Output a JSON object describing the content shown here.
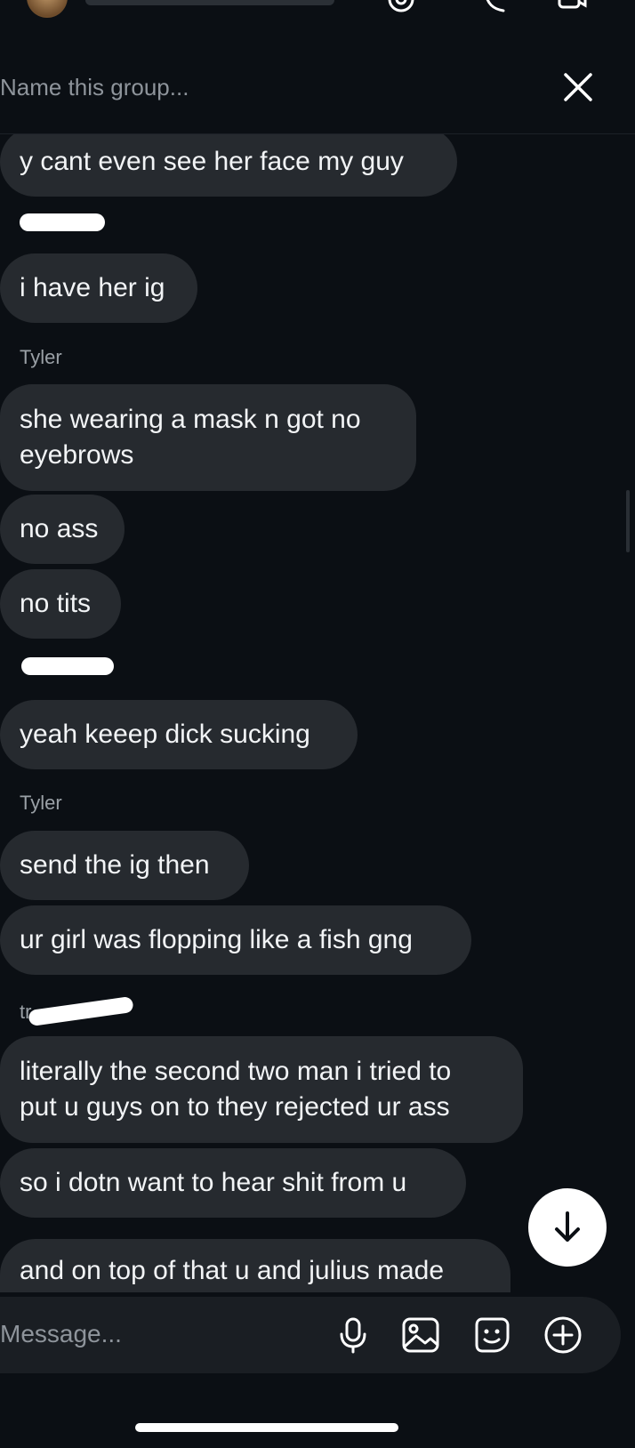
{
  "header": {
    "group_name_placeholder": "Name this group...",
    "close_icon": "close-icon"
  },
  "messages": [
    {
      "text": "y cant even see her face my guy"
    },
    {
      "text": "i have her ig"
    },
    {
      "sender": "Tyler"
    },
    {
      "text": "she wearing a mask n got no eyebrows"
    },
    {
      "text": "no ass"
    },
    {
      "text": "no tits"
    },
    {
      "text": "yeah keeep dick sucking"
    },
    {
      "sender": "Tyler"
    },
    {
      "text": "send the ig then"
    },
    {
      "text": "ur girl was flopping like a fish gng"
    },
    {
      "sender_fragment": "tr"
    },
    {
      "text": "literally the second two man i tried to put u guys on to they rejected ur ass"
    },
    {
      "text": "so i dotn want to hear shit from u"
    },
    {
      "text": "and on top of that u and julius made"
    }
  ],
  "composer": {
    "message_placeholder": "Message...",
    "icons": [
      "microphone-icon",
      "image-icon",
      "sticker-icon",
      "plus-circle-icon"
    ]
  },
  "colors": {
    "background": "#0b0f14",
    "bubble": "#262a2f",
    "text": "#f2f4f6",
    "muted": "#8e949b"
  }
}
